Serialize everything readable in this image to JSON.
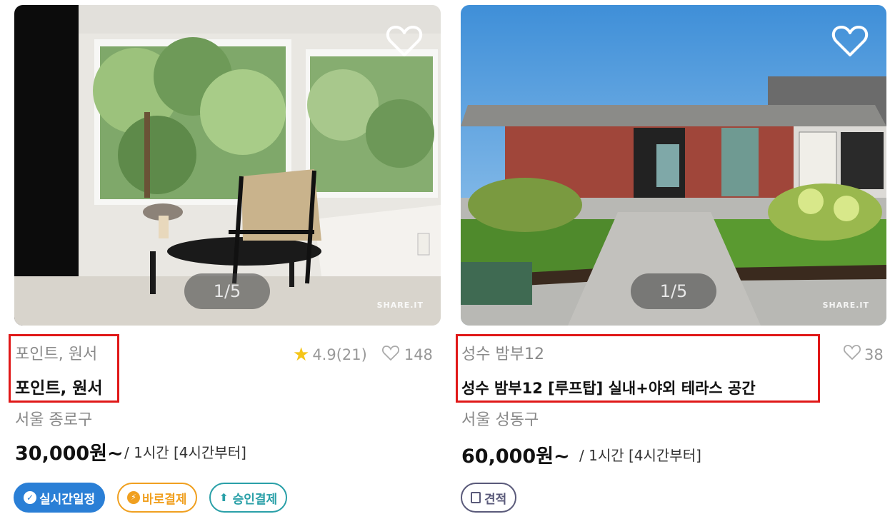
{
  "cards": [
    {
      "pager": "1/5",
      "watermark": "SHARE.IT",
      "category": "포인트, 원서",
      "title": "포인트, 원서",
      "rating": "4.9(21)",
      "likes": "148",
      "location": "서울 종로구",
      "price": "30,000원~",
      "unit": "/ 1시간 [4시간부터]",
      "tags": [
        "실시간일정",
        "바로결제",
        "승인결제"
      ]
    },
    {
      "pager": "1/5",
      "watermark": "SHARE.IT",
      "category": "성수 밤부12",
      "title": "성수 밤부12 [루프탑] 실내+야외 테라스 공간",
      "likes": "38",
      "location": "서울 성동구",
      "price": "60,000원~",
      "unit": "/ 1시간 [4시간부터]",
      "tags": [
        "견적"
      ]
    }
  ],
  "colors": {
    "highlight": "#e01818",
    "tag_realtime": "#2a7fd6",
    "tag_direct": "#f0a020",
    "tag_approve": "#2aa0a8",
    "tag_quote": "#5a5a7a",
    "star": "#f5c518"
  }
}
